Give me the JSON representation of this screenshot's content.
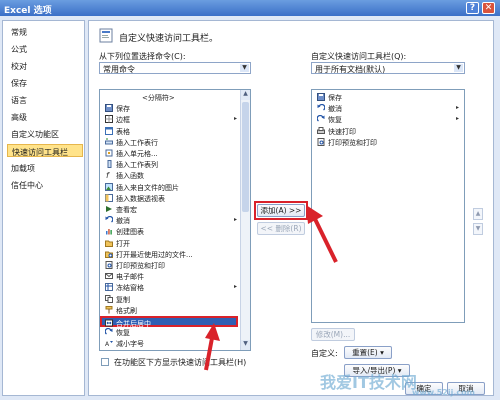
{
  "window": {
    "title": "Excel 选项",
    "help_label": "?",
    "close_label": "✕"
  },
  "nav": {
    "items": [
      {
        "label": "常规"
      },
      {
        "label": "公式"
      },
      {
        "label": "校对"
      },
      {
        "label": "保存"
      },
      {
        "label": "语言"
      },
      {
        "label": "高级"
      },
      {
        "label": "自定义功能区"
      },
      {
        "label": "快速访问工具栏",
        "active": true
      },
      {
        "label": "加载项"
      },
      {
        "label": "信任中心"
      }
    ]
  },
  "main": {
    "heading": "自定义快速访问工具栏。",
    "choose_label": "从下列位置选择命令(C):",
    "choose_value": "常用命令",
    "customize_label": "自定义快速访问工具栏(Q):",
    "customize_value": "用于所有文档(默认)",
    "commands": [
      {
        "label": "<分隔符>",
        "icon": "none"
      },
      {
        "label": "保存",
        "icon": "save-icon"
      },
      {
        "label": "边框",
        "icon": "border-icon",
        "sub": "▸"
      },
      {
        "label": "表格",
        "icon": "table-icon"
      },
      {
        "label": "插入工作表行",
        "icon": "insert-row-icon"
      },
      {
        "label": "插入单元格...",
        "icon": "insert-cell-icon"
      },
      {
        "label": "插入工作表列",
        "icon": "insert-col-icon"
      },
      {
        "label": "插入函数",
        "icon": "function-icon"
      },
      {
        "label": "插入来自文件的图片",
        "icon": "picture-icon"
      },
      {
        "label": "插入数据透视表",
        "icon": "pivot-icon"
      },
      {
        "label": "查看宏",
        "icon": "macro-icon"
      },
      {
        "label": "撤消",
        "icon": "undo-icon",
        "sub": "▸"
      },
      {
        "label": "创建图表",
        "icon": "chart-icon"
      },
      {
        "label": "打开",
        "icon": "open-icon"
      },
      {
        "label": "打开最近使用过的文件...",
        "icon": "recent-icon"
      },
      {
        "label": "打印预览和打印",
        "icon": "print-preview-icon"
      },
      {
        "label": "电子邮件",
        "icon": "email-icon"
      },
      {
        "label": "冻结窗格",
        "icon": "freeze-icon",
        "sub": "▸"
      },
      {
        "label": "复制",
        "icon": "copy-icon"
      },
      {
        "label": "格式刷",
        "icon": "format-painter-icon"
      },
      {
        "label": "合并后居中",
        "icon": "merge-center-icon",
        "selected": true
      },
      {
        "label": "恢复",
        "icon": "redo-icon"
      },
      {
        "label": "减小字号",
        "icon": "shrink-font-icon"
      }
    ],
    "toolbar_items": [
      {
        "label": "保存",
        "icon": "save-icon"
      },
      {
        "label": "撤消",
        "icon": "undo-icon",
        "sub": "▸"
      },
      {
        "label": "恢复",
        "icon": "redo-icon",
        "sub": "▸"
      },
      {
        "label": "快速打印",
        "icon": "quick-print-icon"
      },
      {
        "label": "打印预览和打印",
        "icon": "print-preview-icon"
      }
    ],
    "add_button": "添加(A) >>",
    "remove_button": "<< 删除(R)",
    "modify_button": "修改(M)...",
    "customize_row_label": "自定义:",
    "reset_button": "重置(E) ▾",
    "import_export_button": "导入/导出(P) ▾",
    "show_below_label": "在功能区下方显示快速访问工具栏(H)",
    "ok_button": "确定",
    "cancel_button": "取消"
  },
  "watermark": {
    "main": "我爱IT技术网",
    "sub": "www.52ij.com"
  },
  "colors": {
    "highlight_red": "#d9222a",
    "selection_blue": "#2f5fb3",
    "active_nav_bg": "#ffe38a"
  }
}
